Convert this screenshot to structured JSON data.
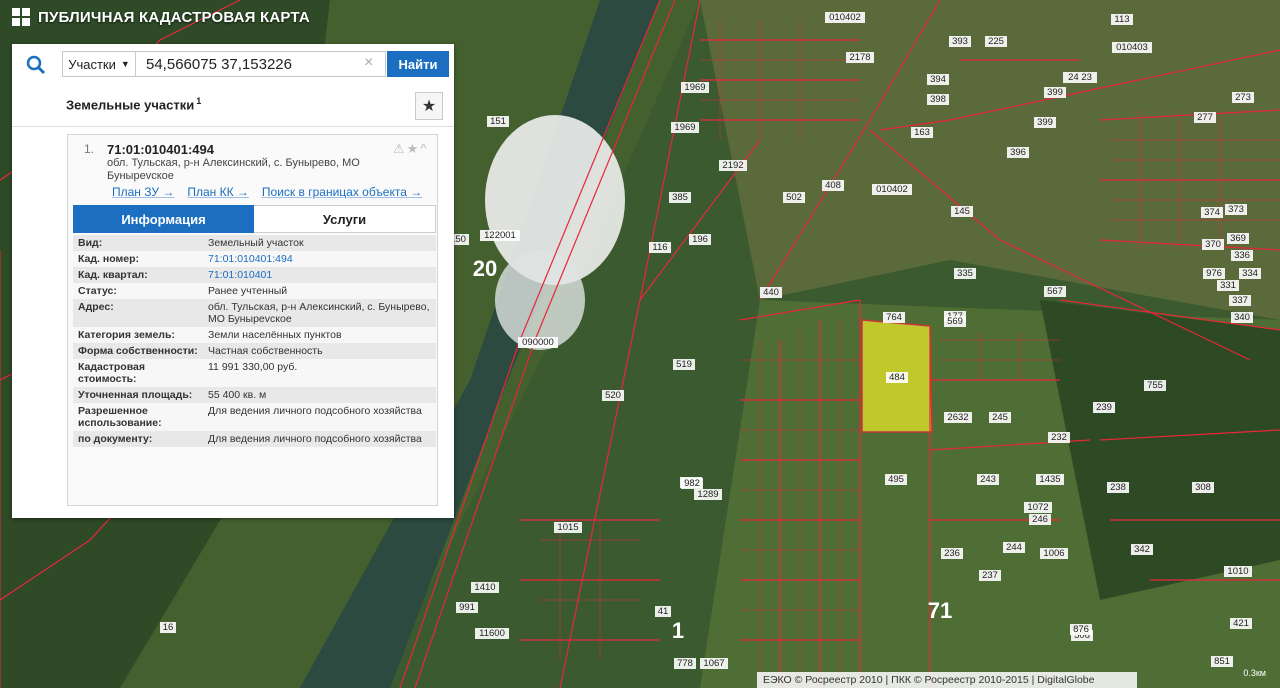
{
  "app": {
    "title": "ПУБЛИЧНАЯ КАДАСТРОВАЯ КАРТА"
  },
  "search": {
    "type_label": "Участки",
    "query": "54,566075 37,153226",
    "clear_icon": "×",
    "button_label": "Найти"
  },
  "results": {
    "section_title": "Земельные участки",
    "count": "1",
    "item": {
      "index": "1.",
      "cad_number": "71:01:010401:494",
      "address": "обл. Тульская, р-н Алексинский, с. Бунырево, МО Бунырevское",
      "links": [
        "План ЗУ →",
        "План КК →",
        "Поиск в границах объекта →"
      ],
      "tabs": [
        "Информация",
        "Услуги"
      ],
      "fields": [
        {
          "k": "Вид:",
          "v": "Земельный участок"
        },
        {
          "k": "Кад. номер:",
          "v": "71:01:010401:494"
        },
        {
          "k": "Кад. квартал:",
          "v": "71:01:010401"
        },
        {
          "k": "Статус:",
          "v": "Ранее учтенный"
        },
        {
          "k": "Адрес:",
          "v": "обл. Тульская, р-н Алексинский, с. Бунырево, МО Бунырevское"
        },
        {
          "k": "Категория земель:",
          "v": "Земли населённых пунктов"
        },
        {
          "k": "Форма собственности:",
          "v": "Частная собственность"
        },
        {
          "k": "Кадастровая стоимость:",
          "v": "11 991 330,00 руб."
        },
        {
          "k": "Уточненная площадь:",
          "v": "55 400 кв. м"
        },
        {
          "k": "Разрешенное использование:",
          "v": "Для ведения личного подсобного хозяйства"
        },
        {
          "k": "по документу:",
          "v": "Для ведения личного подсобного хозяйства"
        }
      ]
    }
  },
  "map": {
    "labels": [
      "010402",
      "393",
      "2178",
      "1969",
      "113",
      "010403",
      "225",
      "399",
      "394",
      "398",
      "24 23",
      "273",
      "151",
      "399",
      "396",
      "277",
      "163",
      "2192",
      "1969",
      "408",
      "010402",
      "150",
      "122001",
      "20",
      "385",
      "196",
      "116",
      "502",
      "145",
      "374",
      "373",
      "369",
      "370",
      "336",
      "335",
      "567",
      "976",
      "334",
      "331",
      "177",
      "440",
      "764",
      "569",
      "337",
      "340",
      "090000",
      "519",
      "484",
      "755",
      "520",
      "2632",
      "245",
      "239",
      "232",
      "1435",
      "495",
      "243",
      "238",
      "308",
      "141",
      "1289",
      "982",
      "1072",
      "1015",
      "236",
      "244",
      "1006",
      "342",
      "246",
      "1010",
      "237",
      "71",
      "421",
      "1",
      "41",
      "506",
      "876",
      "1410",
      "991",
      "11600",
      "778",
      "1067",
      "851",
      "16"
    ],
    "highlight_parcel": "484",
    "colors": {
      "parcel_line": "#e8273a",
      "highlight": "#e6e62a"
    }
  },
  "footer": {
    "copyright": "ЕЭКО © Росреестр 2010 | ПКК © Росреестр 2010-2015 | DigitalGlobe",
    "scale": "0.3км"
  }
}
